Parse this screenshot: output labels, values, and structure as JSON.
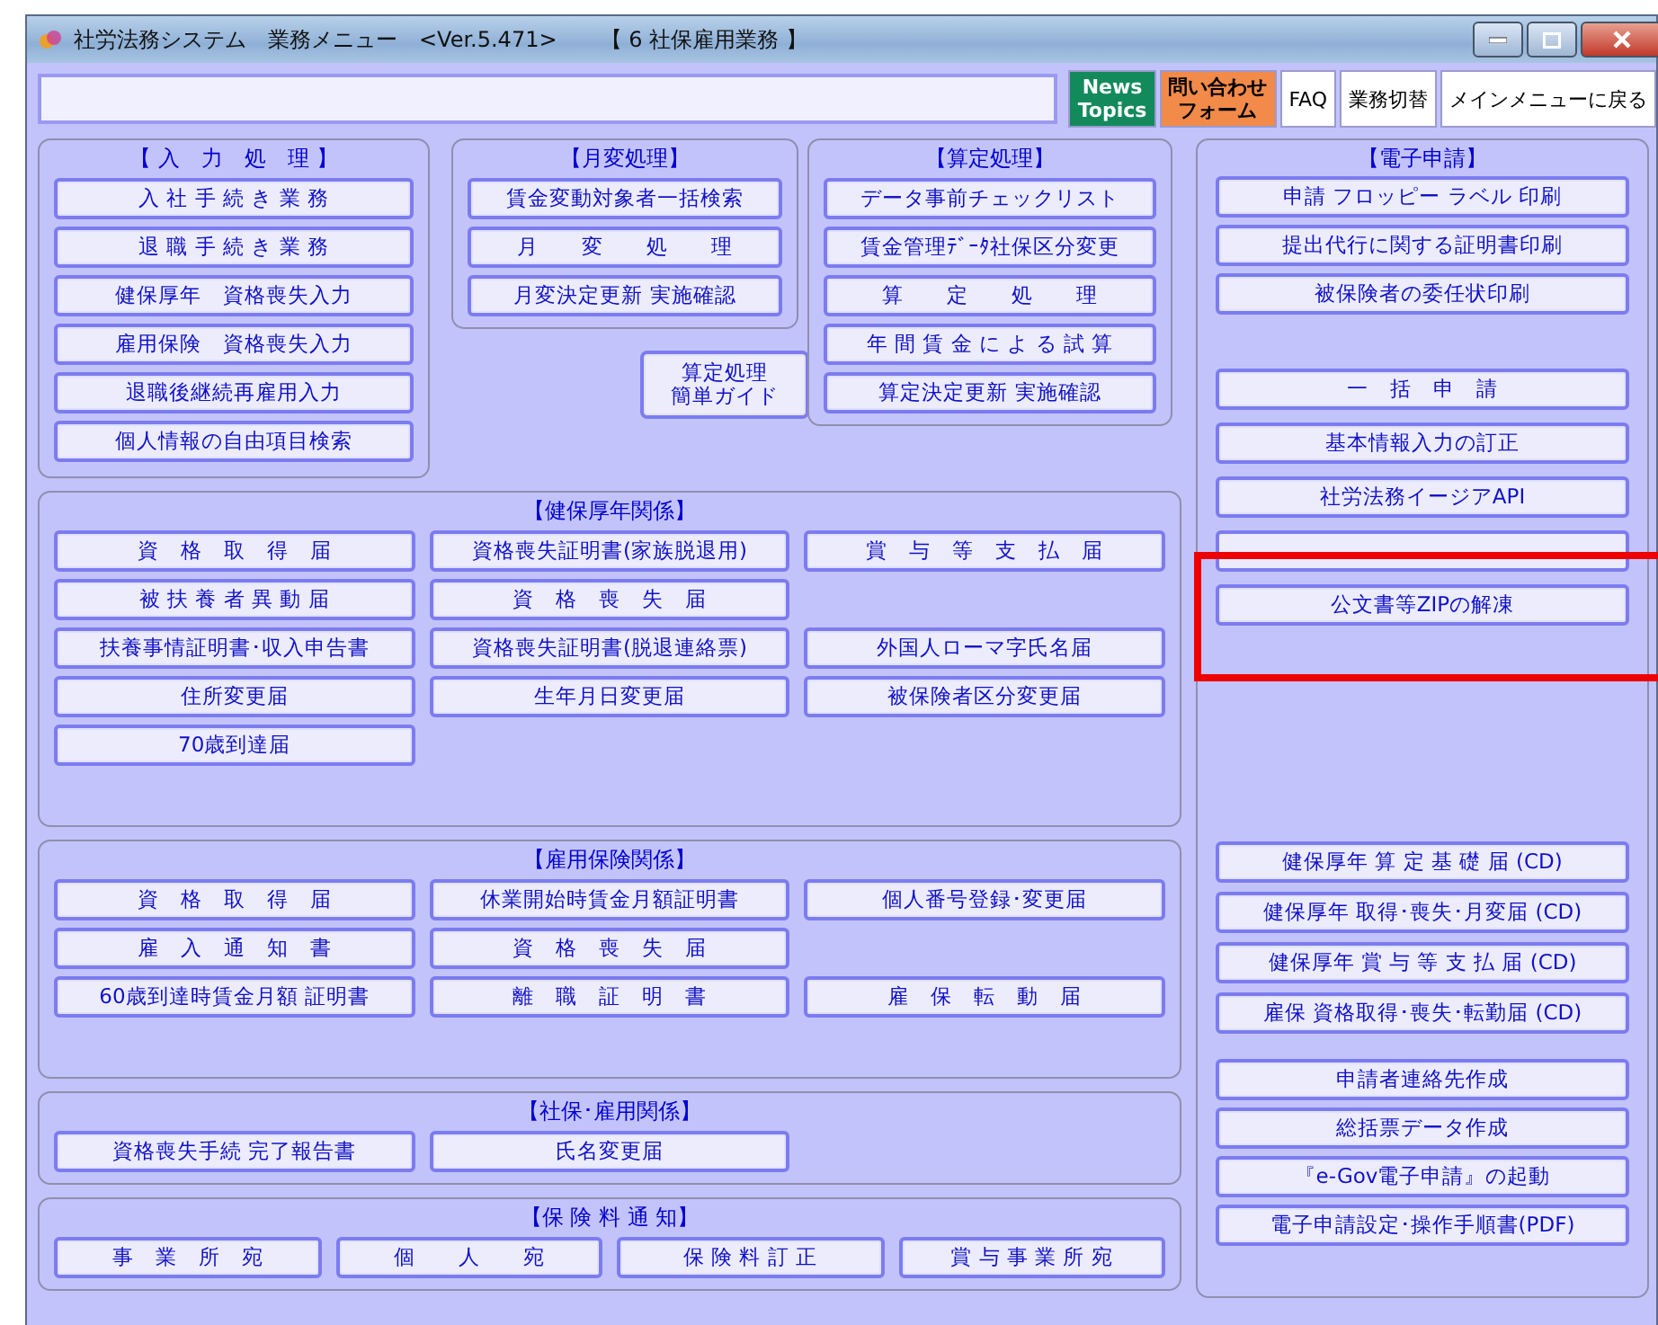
{
  "window": {
    "title": "社労法務システム　業務メニュー　<Ver.5.471>　　【 6 社保雇用業務 】"
  },
  "toolbar": {
    "buttons": [
      {
        "kind": "news",
        "lines": [
          "News",
          "Topics"
        ]
      },
      {
        "kind": "contact",
        "lines": [
          "問い合わせ",
          "フォーム"
        ]
      },
      {
        "kind": "plain",
        "lines": [
          "FAQ"
        ]
      },
      {
        "kind": "plain",
        "lines": [
          "業務切替"
        ]
      },
      {
        "kind": "plain",
        "lines": [
          "メインメニューに戻る"
        ]
      }
    ]
  },
  "input_panel": {
    "title": "【 入　力　処　理 】",
    "buttons": [
      "入 社 手 続 き 業 務",
      "退 職 手 続 き 業 務",
      "健保厚年　資格喪失入力",
      "雇用保険　資格喪失入力",
      "退職後継続再雇用入力",
      "個人情報の自由項目検索"
    ]
  },
  "monthly_panel": {
    "title": "【月変処理】",
    "buttons": [
      "賃金変動対象者一括検索",
      "月　　変　　処　　理",
      "月変決定更新 実施確認"
    ]
  },
  "guide_button": {
    "lines": [
      "算定処理",
      "簡単ガイド"
    ]
  },
  "santei_panel": {
    "title": "【算定処理】",
    "buttons": [
      "データ事前チェックリスト",
      "賃金管理ﾃﾞｰﾀ社保区分変更",
      "算　　定　　処　　理",
      "年 間 賃 金 に よ る 試 算",
      "算定決定更新 実施確認"
    ]
  },
  "health_panel": {
    "title": "【健保厚年関係】",
    "rows": [
      [
        "資　格　取　得　届",
        "資格喪失証明書(家族脱退用)",
        "賞　与　等　支　払　届"
      ],
      [
        "被 扶 養 者 異 動 届",
        "資　格　喪　失　届",
        null
      ],
      [
        "扶養事情証明書･収入申告書",
        "資格喪失証明書(脱退連絡票)",
        "外国人ローマ字氏名届"
      ],
      [
        "住所変更届",
        "生年月日変更届",
        "被保険者区分変更届"
      ],
      [
        "70歳到達届",
        null,
        null
      ]
    ]
  },
  "employment_panel": {
    "title": "【雇用保険関係】",
    "rows": [
      [
        "資　格　取　得　届",
        "休業開始時賃金月額証明書",
        "個人番号登録･変更届"
      ],
      [
        "雇　入　通　知　書",
        "資　格　喪　失　届",
        null
      ],
      [
        "60歳到達時賃金月額 証明書",
        "離　職　証　明　書",
        "雇　保　転　動　届"
      ]
    ]
  },
  "social_panel": {
    "title": "【社保･雇用関係】",
    "rows": [
      [
        "資格喪失手続 完了報告書",
        "氏名変更届",
        null
      ]
    ]
  },
  "premium_panel": {
    "title": "【保 険 料 通 知】",
    "buttons": [
      "事　業　所　宛",
      "個　　人　　宛",
      "保 険 料 訂 正",
      "賞 与 事 業 所 宛"
    ]
  },
  "e_application": {
    "title": "【電子申請】",
    "groups": [
      [
        {
          "kind": "button",
          "label": "申請 フロッピー ラベル 印刷"
        },
        {
          "kind": "button",
          "label": "提出代行に関する証明書印刷"
        },
        {
          "kind": "button",
          "label": "被保険者の委任状印刷"
        }
      ],
      [
        {
          "kind": "button",
          "label": "一　括　申　請"
        },
        {
          "kind": "button",
          "label": "基本情報入力の訂正"
        },
        {
          "kind": "button",
          "label": "社労法務イージアAPI"
        },
        {
          "kind": "blank"
        },
        {
          "kind": "button",
          "label": "公文書等ZIPの解凍"
        }
      ],
      [
        {
          "kind": "button",
          "label": "健保厚年 算 定 基 礎 届 (CD)"
        },
        {
          "kind": "button",
          "label": "健保厚年 取得･喪失･月変届 (CD)"
        },
        {
          "kind": "button",
          "label": "健保厚年 賞 与 等 支 払 届 (CD)"
        },
        {
          "kind": "button",
          "label": "雇保 資格取得･喪失･転勤届 (CD)"
        }
      ],
      [
        {
          "kind": "button",
          "label": "申請者連絡先作成"
        },
        {
          "kind": "button",
          "label": "総括票データ作成"
        },
        {
          "kind": "button",
          "label": "『e-Gov電子申請』の起動"
        },
        {
          "kind": "button",
          "label": "電子申請設定･操作手順書(PDF)"
        }
      ]
    ],
    "highlight": {
      "color": "#ee0000"
    }
  }
}
